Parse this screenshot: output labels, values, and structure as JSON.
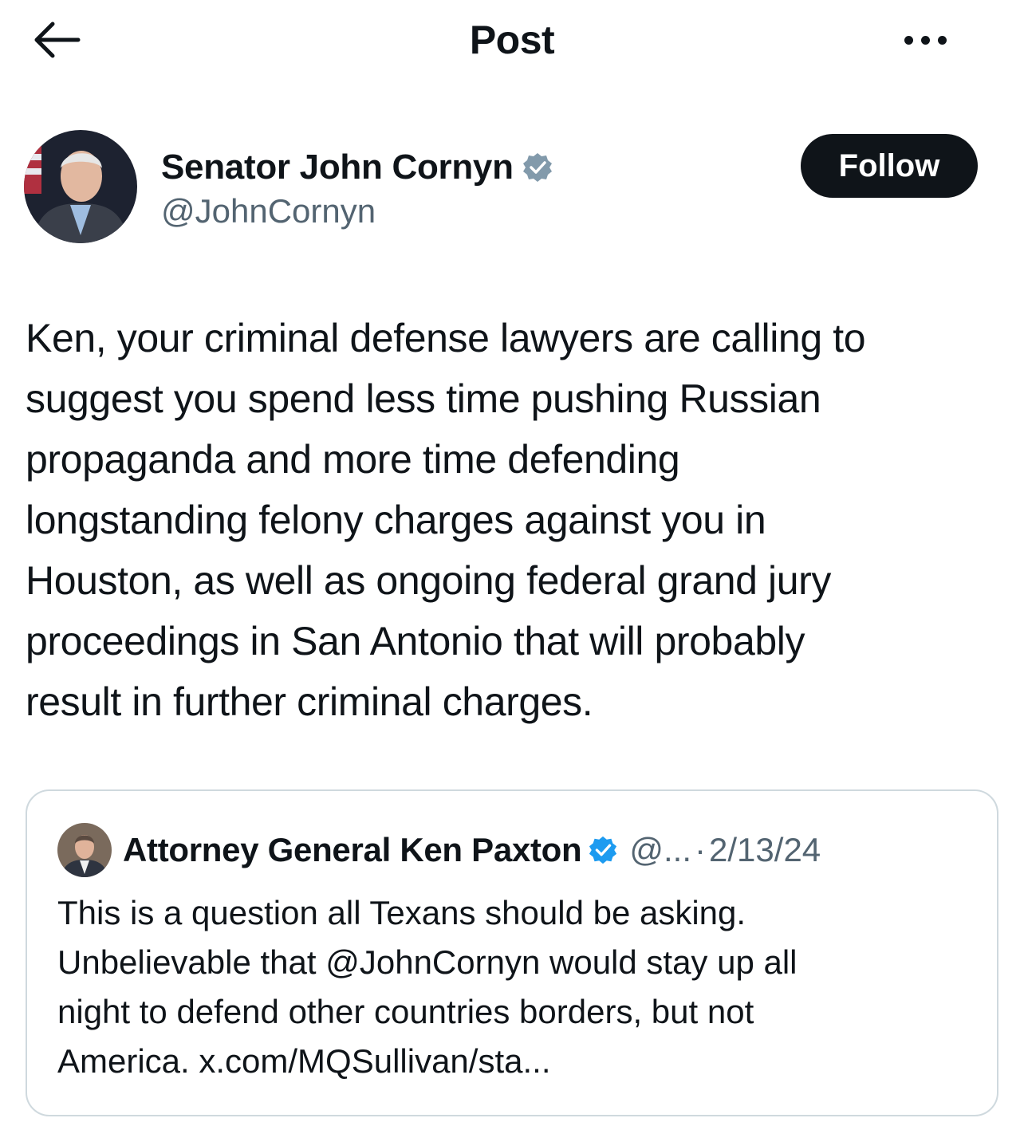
{
  "header": {
    "title": "Post",
    "back_icon": "arrow-left-icon",
    "more_icon": "more-horizontal-icon"
  },
  "author": {
    "name": "Senator John Cornyn",
    "handle": "@JohnCornyn",
    "verified_badge": "verified-gray-badge-icon",
    "follow_label": "Follow"
  },
  "post": {
    "text": "Ken, your criminal defense lawyers are calling to\nsuggest you spend less time pushing Russian\npropaganda and more time defending\nlongstanding felony charges against you in\nHouston, as well as ongoing federal grand jury\nproceedings in San Antonio that will probably\nresult in further criminal charges."
  },
  "quote": {
    "name": "Attorney General Ken Paxton",
    "verified_badge": "verified-blue-badge-icon",
    "handle": "@...",
    "separator": "·",
    "date": "2/13/24",
    "text": "This is a question all Texans should be asking.\nUnbelievable that @JohnCornyn would stay up all\nnight to defend other countries borders, but not\nAmerica. x.com/MQSullivan/sta..."
  },
  "colors": {
    "text_primary": "#0f1419",
    "text_secondary": "#536471",
    "follow_bg": "#0f1419",
    "verified_gray": "#829aab",
    "verified_blue": "#1d9bf0",
    "border": "#cfd9de"
  }
}
